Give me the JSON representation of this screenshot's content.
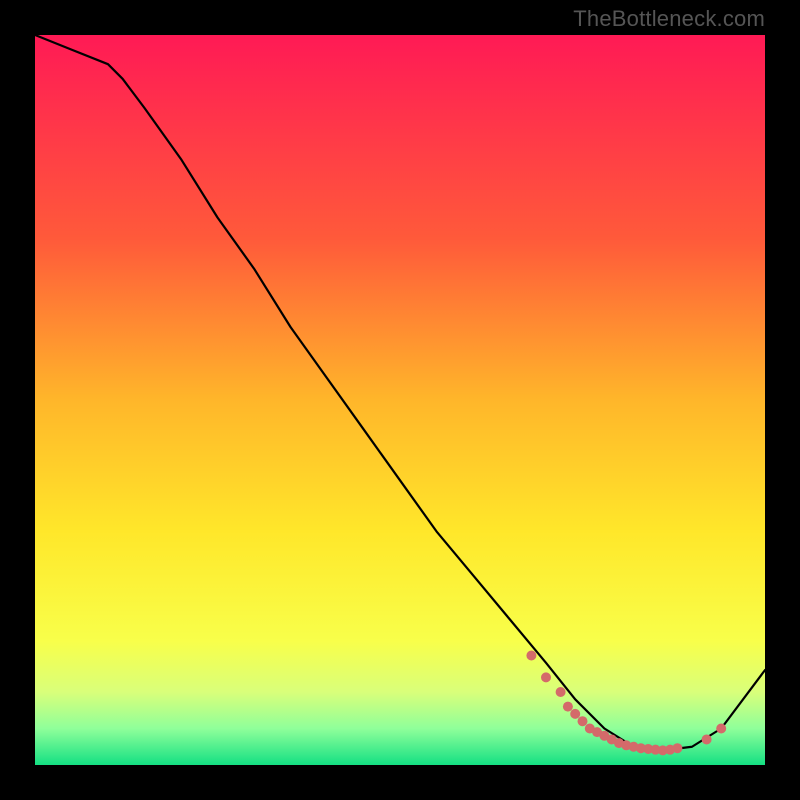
{
  "attribution": "TheBottleneck.com",
  "chart_data": {
    "type": "line",
    "title": "",
    "xlabel": "",
    "ylabel": "",
    "xlim": [
      0,
      100
    ],
    "ylim": [
      0,
      100
    ],
    "x": [
      0,
      5,
      10,
      12,
      15,
      20,
      25,
      30,
      35,
      40,
      45,
      50,
      55,
      60,
      65,
      70,
      74,
      78,
      82,
      86,
      90,
      94,
      100
    ],
    "values": [
      100,
      98,
      96,
      94,
      90,
      83,
      75,
      68,
      60,
      53,
      46,
      39,
      32,
      26,
      20,
      14,
      9,
      5,
      2.5,
      2,
      2.5,
      5,
      13
    ],
    "background_gradient": [
      {
        "stop": 0.0,
        "color": "#ff1a55"
      },
      {
        "stop": 0.28,
        "color": "#ff5a3a"
      },
      {
        "stop": 0.5,
        "color": "#ffb62a"
      },
      {
        "stop": 0.68,
        "color": "#ffe72a"
      },
      {
        "stop": 0.83,
        "color": "#f8ff4a"
      },
      {
        "stop": 0.9,
        "color": "#d9ff7a"
      },
      {
        "stop": 0.95,
        "color": "#8fff9a"
      },
      {
        "stop": 1.0,
        "color": "#14e083"
      }
    ],
    "markers": {
      "x": [
        68,
        70,
        72,
        73,
        74,
        75,
        76,
        77,
        78,
        79,
        80,
        81,
        82,
        83,
        84,
        85,
        86,
        87,
        88,
        92,
        94
      ],
      "values": [
        15,
        12,
        10,
        8,
        7,
        6,
        5,
        4.5,
        4,
        3.5,
        3,
        2.7,
        2.5,
        2.3,
        2.2,
        2.1,
        2,
        2.1,
        2.3,
        3.5,
        5
      ],
      "color": "#d46a6a",
      "radius": 5
    }
  }
}
